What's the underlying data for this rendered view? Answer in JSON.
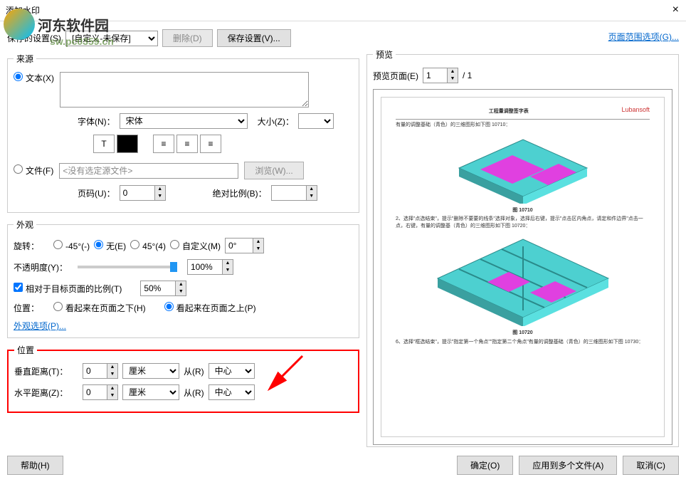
{
  "title": "添加水印",
  "logo_text": "河东软件园",
  "url_watermark": "sw.pc0359.cn",
  "toolbar": {
    "saved_label": "保存的设置(S)",
    "saved_value": "[自定义-未保存]",
    "delete_btn": "删除(D)",
    "save_btn": "保存设置(V)...",
    "page_range_link": "页面范围选项(G)..."
  },
  "source": {
    "legend": "来源",
    "text_radio": "文本(X)",
    "font_label": "字体(N)：",
    "font_value": "宋体",
    "size_label": "大小(Z)：",
    "file_radio": "文件(F)",
    "file_placeholder": "<没有选定源文件>",
    "browse_btn": "浏览(W)...",
    "page_label": "页码(U)：",
    "page_value": "0",
    "scale_label": "绝对比例(B)："
  },
  "appearance": {
    "legend": "外观",
    "rotate_label": "旋转：",
    "rotate_neg45": "-45°(-)",
    "rotate_none": "无(E)",
    "rotate_45": "45°(4)",
    "rotate_custom": "自定义(M)",
    "rotate_value": "0°",
    "opacity_label": "不透明度(Y)：",
    "opacity_value": "100%",
    "relative_check": "相对于目标页面的比例(T)",
    "relative_value": "50%",
    "position_label": "位置：",
    "pos_below": "看起来在页面之下(H)",
    "pos_above": "看起来在页面之上(P)",
    "options_link": "外观选项(P)..."
  },
  "position": {
    "legend": "位置",
    "vert_label": "垂直距离(T)：",
    "vert_value": "0",
    "vert_unit": "厘米",
    "from_label": "从(R)",
    "center": "中心",
    "horiz_label": "水平距离(Z)：",
    "horiz_value": "0",
    "horiz_unit": "厘米"
  },
  "preview": {
    "legend": "预览",
    "page_label": "预览页面(E)",
    "page_value": "1",
    "page_total": "/ 1",
    "doc_title": "工程量调整签字表",
    "doc_logo": "Lubansoft",
    "doc_line1": "有量的调整基础（青色）的三维图形如下图 10710：",
    "doc_fig1": "图 10710",
    "doc_line2": "2、选择\"点选结束\"，提示\"删除不要要的线条\"选择对象，选择后右键，提示\"点击区内角点，请定和件边界\"点击一点，右键，有量的调整基（青色）的三维图形如下图 10720：",
    "doc_fig2": "图 10720",
    "doc_line3": "6、选择\"框选结束\"，提示\"指定第一个角点\"\"指定第二个角点\"有量的调整基础（青色）的三维图形如下图 10730："
  },
  "buttons": {
    "help": "帮助(H)",
    "ok": "确定(O)",
    "apply_multi": "应用到多个文件(A)",
    "cancel": "取消(C)"
  }
}
